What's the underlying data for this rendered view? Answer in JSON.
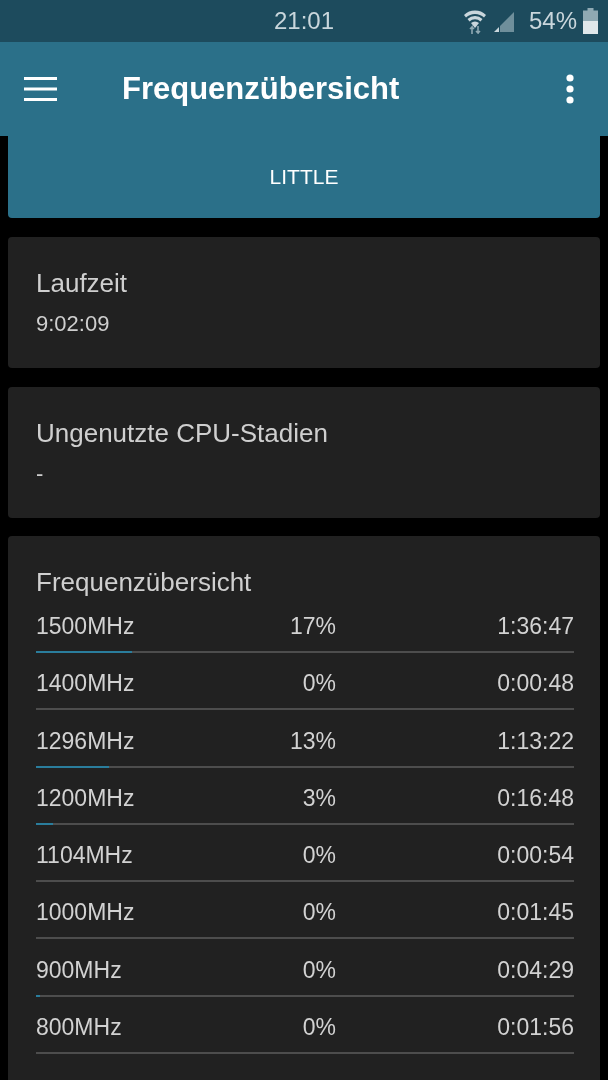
{
  "status_bar": {
    "time": "21:01",
    "battery": "54%"
  },
  "app_bar": {
    "title": "Frequenzübersicht"
  },
  "tabs": [
    {
      "label": "LITTLE",
      "selected": true
    }
  ],
  "cards": [
    {
      "title": "Laufzeit",
      "value": "9:02:09"
    },
    {
      "title": "Ungenutzte CPU-Stadien",
      "value": "-"
    }
  ],
  "frequency_card": {
    "title": "Frequenzübersicht",
    "rows": [
      {
        "frequency": "1500MHz",
        "percent": "17%",
        "time": "1:36:47",
        "level": 0.178
      },
      {
        "frequency": "1400MHz",
        "percent": "0%",
        "time": "0:00:48"
      },
      {
        "frequency": "1296MHz",
        "percent": "13%",
        "time": "1:13:22",
        "level": 0.135
      },
      {
        "frequency": "1200MHz",
        "percent": "3%",
        "time": "0:16:48",
        "level": 0.031
      },
      {
        "frequency": "1104MHz",
        "percent": "0%",
        "time": "0:00:54"
      },
      {
        "frequency": "1000MHz",
        "percent": "0%",
        "time": "0:01:45"
      },
      {
        "frequency": "900MHz",
        "percent": "0%",
        "time": "0:04:29",
        "level": 0.008
      },
      {
        "frequency": "800MHz",
        "percent": "0%",
        "time": "0:01:56"
      }
    ]
  }
}
